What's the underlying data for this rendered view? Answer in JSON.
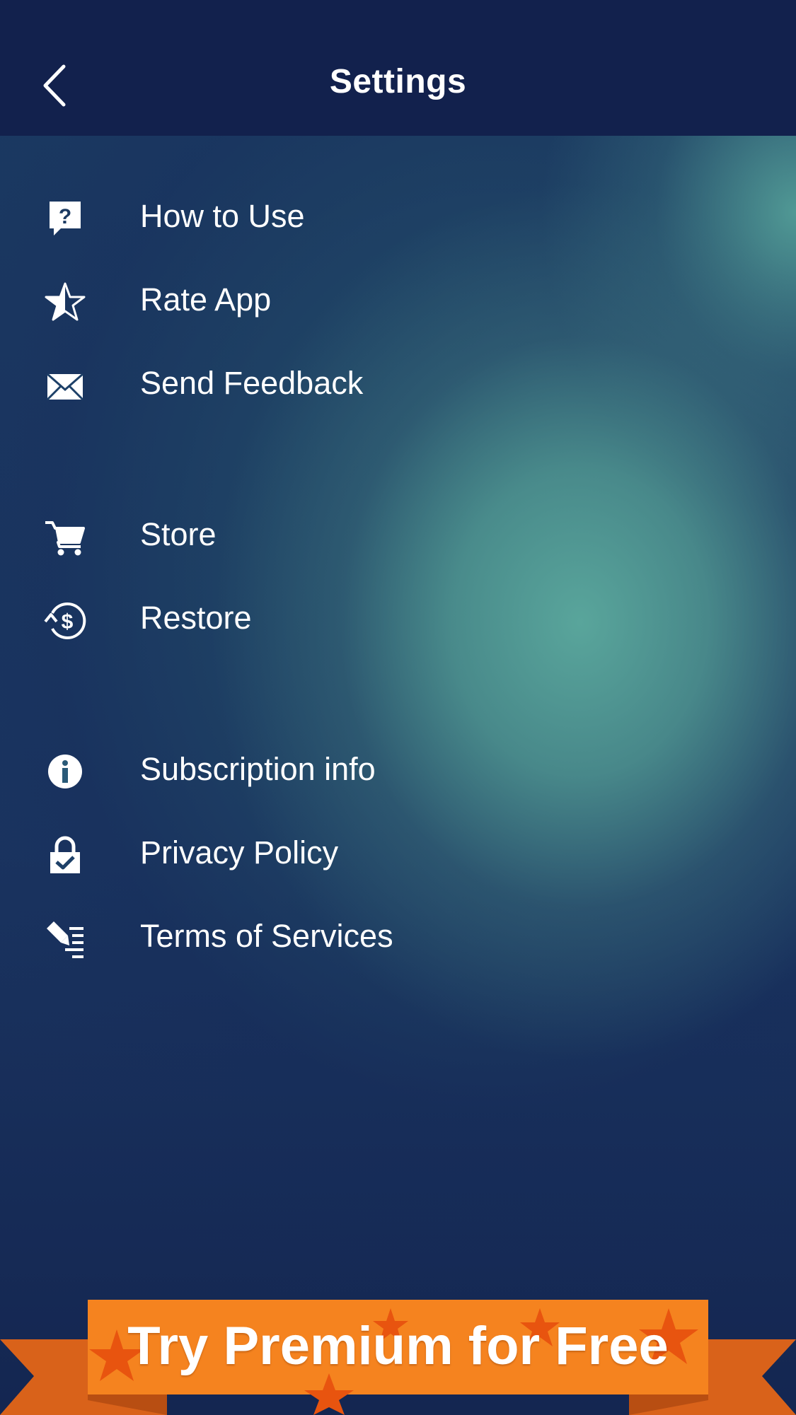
{
  "header": {
    "title": "Settings",
    "back_icon": "chevron-left-icon"
  },
  "menu": {
    "group1": [
      {
        "label": "How to Use",
        "icon": "help-bubble-icon"
      },
      {
        "label": "Rate App",
        "icon": "star-icon"
      },
      {
        "label": "Send Feedback",
        "icon": "envelope-icon"
      }
    ],
    "group2": [
      {
        "label": "Store",
        "icon": "cart-icon"
      },
      {
        "label": "Restore",
        "icon": "restore-dollar-icon"
      }
    ],
    "group3": [
      {
        "label": "Subscription info",
        "icon": "info-icon"
      },
      {
        "label": "Privacy Policy",
        "icon": "lock-check-icon"
      },
      {
        "label": "Terms of Services",
        "icon": "terms-document-icon"
      }
    ]
  },
  "banner": {
    "text": "Try Premium for Free",
    "colors": {
      "orange": "#f5831f",
      "dark_orange": "#d9621a",
      "star": "#e8540f"
    }
  },
  "colors": {
    "header_bg": "#12214d",
    "accent_teal": "#5aa89d",
    "text": "#ffffff"
  }
}
